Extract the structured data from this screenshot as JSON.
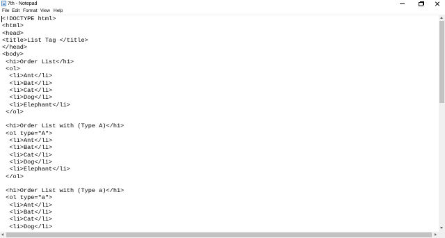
{
  "window": {
    "title": "7th - Notepad",
    "icon": "notepad-icon"
  },
  "menu": {
    "file": "File",
    "edit": "Edit",
    "format": "Format",
    "view": "View",
    "help": "Help"
  },
  "editor": {
    "content": "<!DOCTYPE html>\n<html>\n<head>\n<title>List Tag </title>\n</head>\n<body>\n <h1>Order List</h1>\n <ol>\n  <li>Ant</li>\n  <li>Bat</li>\n  <li>Cat</li>\n  <li>Dog</li>\n  <li>Elephant</li>\n </ol>\n\n <h1>Order List with (Type A)</h1>\n <ol type=\"A\">\n  <li>Ant</li>\n  <li>Bat</li>\n  <li>Cat</li>\n  <li>Dog</li>\n  <li>Elephant</li>\n </ol>\n\n <h1>Order List with (Type a)</h1>\n <ol type=\"a\">\n  <li>Ant</li>\n  <li>Bat</li>\n  <li>Cat</li>\n  <li>Dog</li>"
  }
}
